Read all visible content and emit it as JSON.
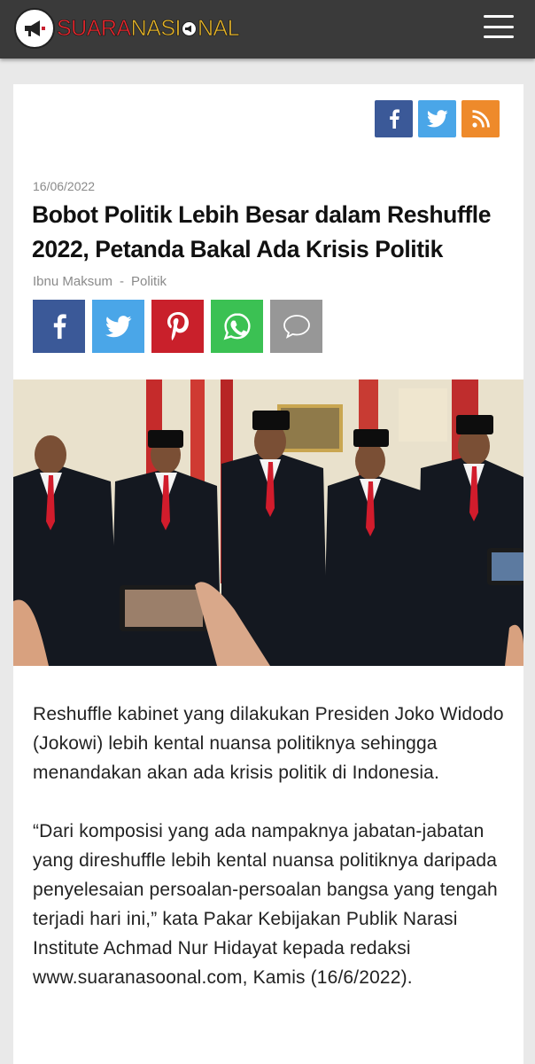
{
  "header": {
    "logo_part1": "SUARA",
    "logo_part2": "NASI",
    "logo_part3": "NAL",
    "menu_icon": "hamburger-icon"
  },
  "follow_icons": [
    "facebook-icon",
    "twitter-icon",
    "rss-icon"
  ],
  "article": {
    "date": "16/06/2022",
    "title": "Bobot Politik Lebih Besar dalam Reshuffle 2022, Petanda Bakal Ada Krisis Politik",
    "author": "Ibnu Maksum",
    "separator": "-",
    "category": "Politik",
    "share_icons": [
      "facebook-icon",
      "twitter-icon",
      "pinterest-icon",
      "whatsapp-icon",
      "sms-icon"
    ],
    "paragraphs": [
      "Reshuffle kabinet yang dilakukan Presiden Joko Widodo (Jokowi) lebih kental nuansa politiknya sehingga menandakan akan ada krisis politik di Indonesia.",
      "“Dari komposisi yang ada nampaknya jabatan-jabatan yang direshuffle lebih kental nuansa politiknya daripada penyelesaian persoalan-persoalan bangsa yang tengah terjadi hari ini,” kata Pakar Kebijakan Publik Narasi Institute Achmad Nur Hidayat kepada redaksi www.suaranasoonal.com, Kamis (16/6/2022)."
    ]
  },
  "colors": {
    "header_bg": "#3a3a3a",
    "facebook": "#3b5998",
    "twitter": "#4aa6e8",
    "rss": "#ee8a2b",
    "pinterest": "#c9202b",
    "whatsapp": "#3bc153",
    "sms": "#979797"
  }
}
